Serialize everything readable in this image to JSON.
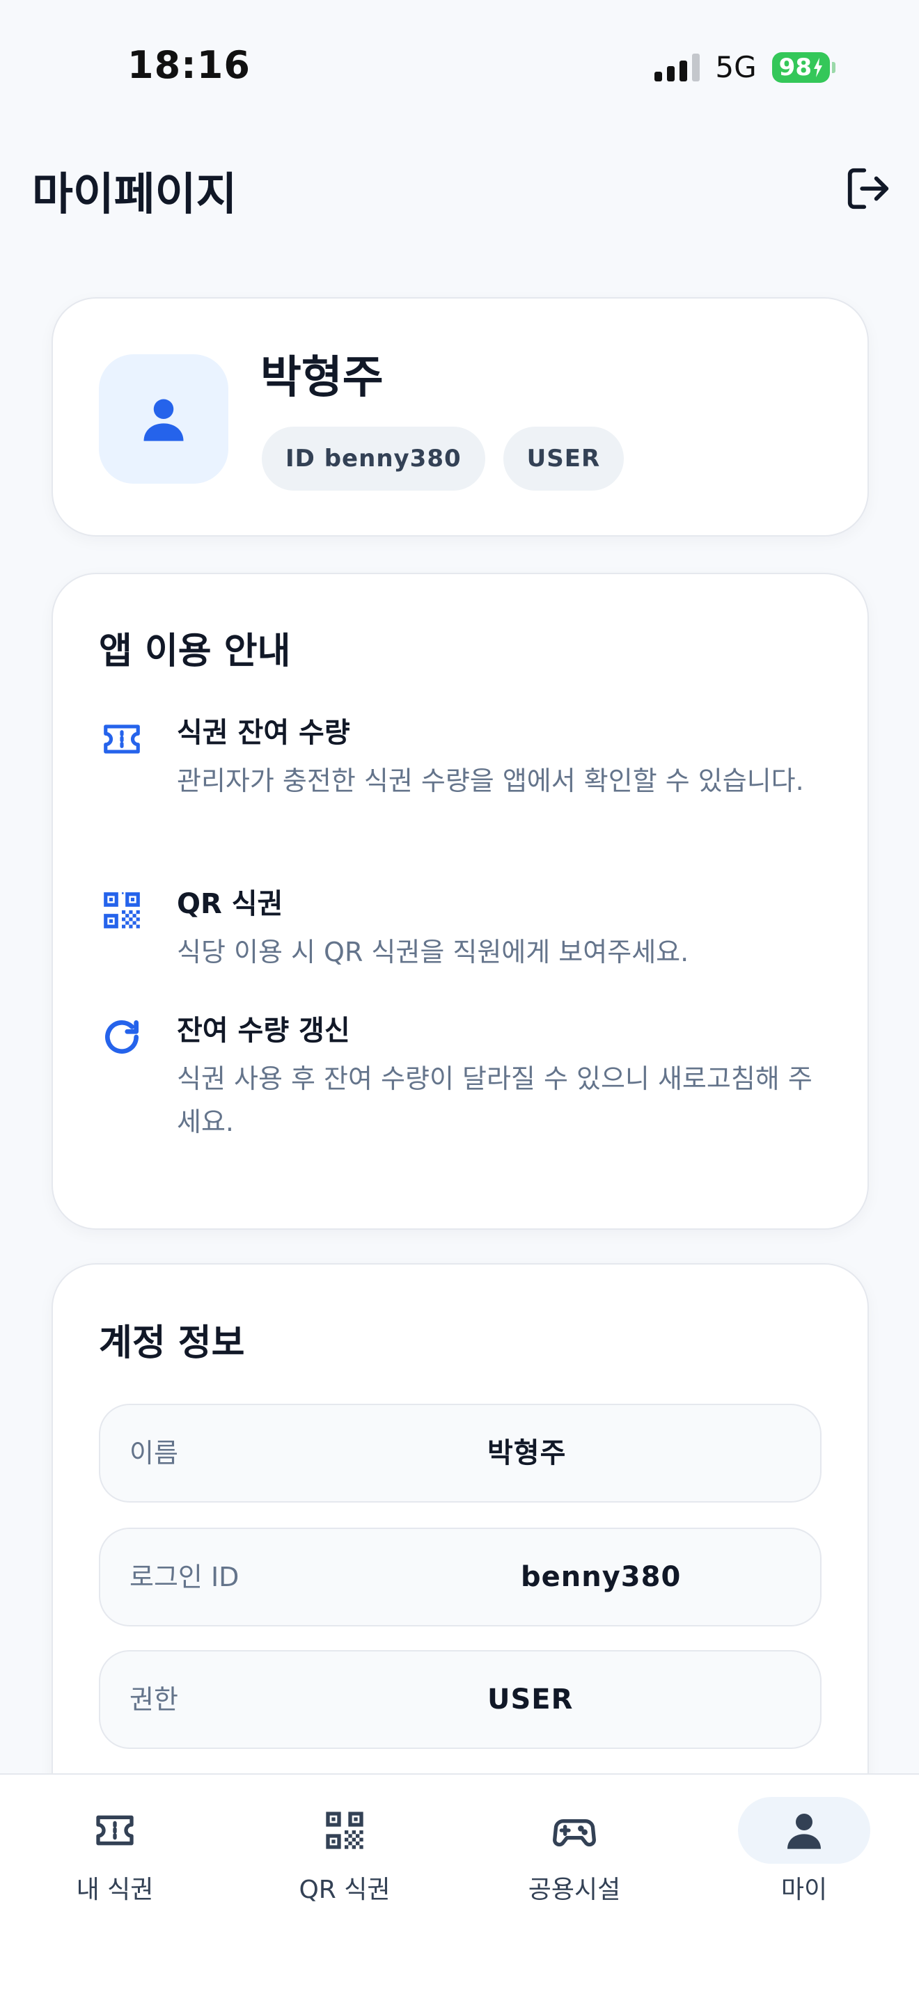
{
  "status_bar": {
    "time": "18:16",
    "network": "5G",
    "battery": "98"
  },
  "header": {
    "title": "마이페이지"
  },
  "profile": {
    "name": "박형주",
    "id_chip": "ID benny380",
    "role_chip": "USER"
  },
  "guide": {
    "title": "앱 이용 안내",
    "items": [
      {
        "icon": "ticket-icon",
        "heading": "식권 잔여 수량",
        "desc": "관리자가 충전한 식권 수량을 앱에서 확인할 수 있습니다."
      },
      {
        "icon": "qr-code-icon",
        "heading": "QR 식권",
        "desc": "식당 이용 시 QR 식권을 직원에게 보여주세요."
      },
      {
        "icon": "refresh-icon",
        "heading": "잔여 수량 갱신",
        "desc": "식권 사용 후 잔여 수량이 달라질 수 있으니 새로고침해 주세요."
      }
    ]
  },
  "account": {
    "title": "계정 정보",
    "rows": [
      {
        "label": "이름",
        "value": "박형주"
      },
      {
        "label": "로그인 ID",
        "value": "benny380"
      },
      {
        "label": "권한",
        "value": "USER"
      }
    ]
  },
  "nav": {
    "items": [
      {
        "label": "내 식권",
        "icon": "ticket-icon"
      },
      {
        "label": "QR 식권",
        "icon": "qr-code-icon"
      },
      {
        "label": "공용시설",
        "icon": "gamepad-icon"
      },
      {
        "label": "마이",
        "icon": "person-icon"
      }
    ],
    "active_index": 3
  },
  "colors": {
    "accent": "#2563eb",
    "battery": "#34c759",
    "avatar_bg": "#eaf3ff"
  }
}
